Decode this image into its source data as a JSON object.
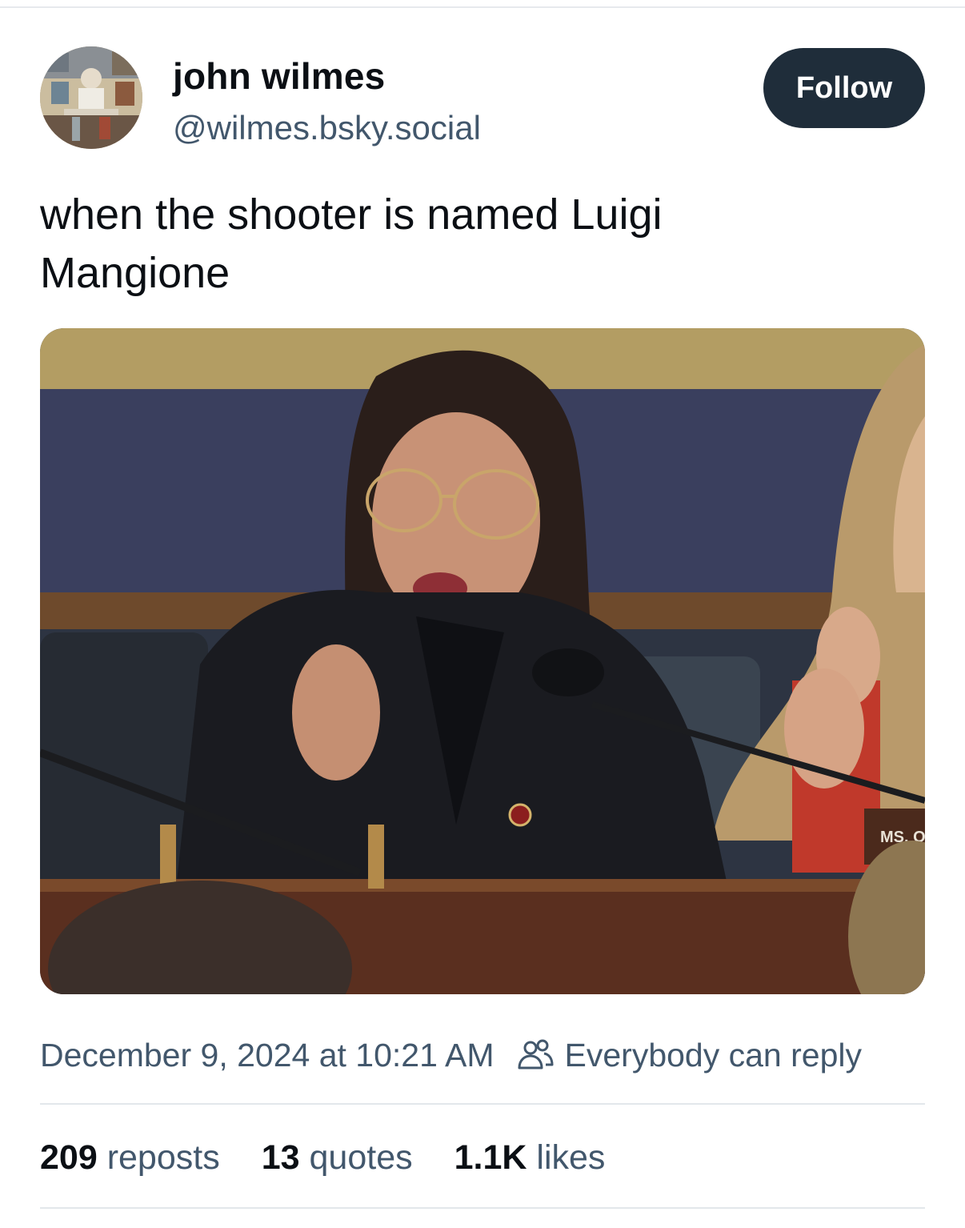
{
  "author": {
    "display_name": "john wilmes",
    "handle": "@wilmes.bsky.social",
    "avatar_icon": "avatar-image"
  },
  "follow_button": {
    "label": "Follow",
    "bg_color": "#1f2d3a"
  },
  "post": {
    "text": "when the shooter is named Luigi Mangione",
    "image": {
      "alt_icon": "photo-image",
      "nameplate_text": "MS. O"
    },
    "timestamp": "December 9, 2024 at 10:21 AM",
    "reply_setting": "Everybody can reply",
    "reply_icon": "people-icon"
  },
  "stats": {
    "reposts_count": "209",
    "reposts_label": "reposts",
    "quotes_count": "13",
    "quotes_label": "quotes",
    "likes_count": "1.1K",
    "likes_label": "likes"
  },
  "colors": {
    "secondary_text": "#42576c",
    "primary_text": "#0b0f14",
    "divider": "#e3e7eb"
  }
}
